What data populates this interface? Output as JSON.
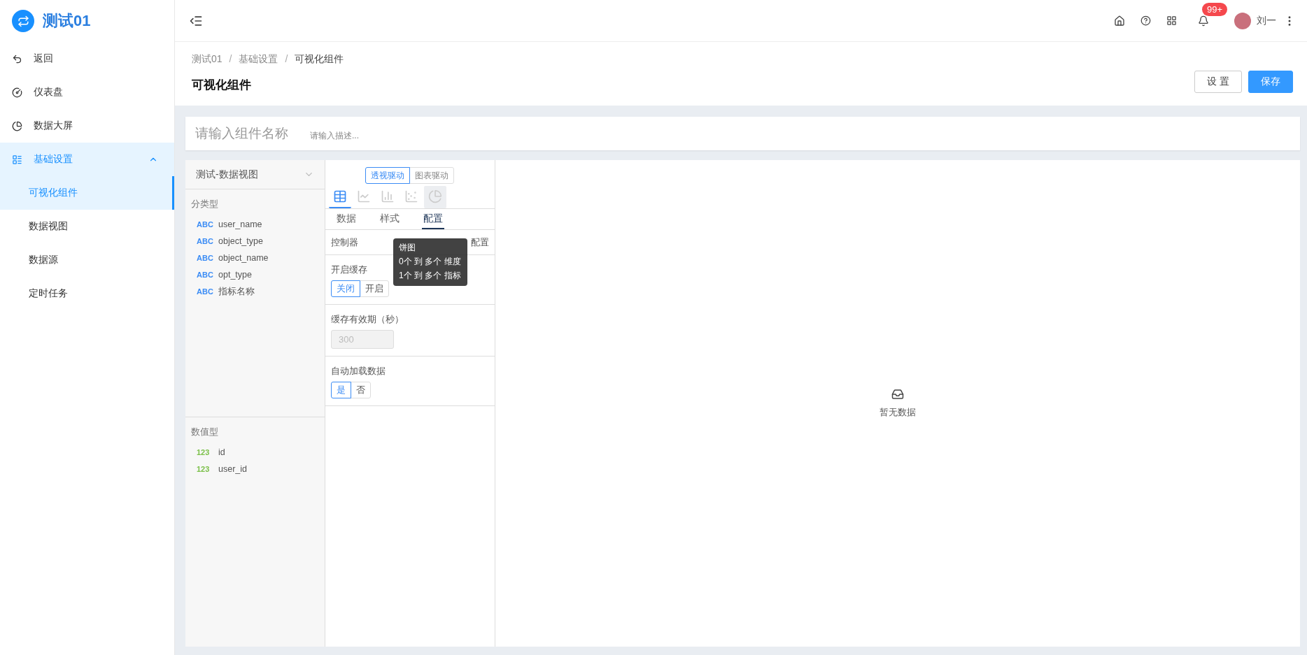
{
  "sidebar": {
    "brand": "测试01",
    "items": [
      {
        "label": "返回",
        "selected": false
      },
      {
        "label": "仪表盘",
        "selected": false
      },
      {
        "label": "数据大屏",
        "selected": false
      },
      {
        "label": "基础设置",
        "selected": false,
        "expanded": true,
        "children": [
          {
            "label": "可视化组件",
            "selected": true
          },
          {
            "label": "数据视图",
            "selected": false
          },
          {
            "label": "数据源",
            "selected": false
          },
          {
            "label": "定时任务",
            "selected": false
          }
        ]
      }
    ]
  },
  "topbar": {
    "badge": "99+",
    "user": "刘一"
  },
  "breadcrumb": {
    "separator": "/",
    "items": [
      "测试01",
      "基础设置",
      "可视化组件"
    ]
  },
  "page_title": "可视化组件",
  "actions": [
    {
      "label": "设 置",
      "kind": "default"
    },
    {
      "label": "保存",
      "kind": "primary"
    }
  ],
  "widget": {
    "name_placeholder": "请输入组件名称",
    "description_placeholder": "请输入描述..."
  },
  "fields": {
    "view": "测试-数据视图",
    "groups": [
      {
        "title": "分类型",
        "kind": "category",
        "items": [
          {
            "type": "ABC",
            "name": "user_name"
          },
          {
            "type": "ABC",
            "name": "object_type"
          },
          {
            "type": "ABC",
            "name": "object_name"
          },
          {
            "type": "ABC",
            "name": "opt_type"
          },
          {
            "type": "ABC",
            "name": "指标名称"
          }
        ]
      },
      {
        "title": "数值型",
        "kind": "value",
        "items": [
          {
            "type": "123",
            "name": "id"
          },
          {
            "type": "123",
            "name": "user_id"
          }
        ]
      }
    ]
  },
  "config": {
    "modes": [
      {
        "label": "透视驱动",
        "selected": true
      },
      {
        "label": "图表驱动",
        "selected": false
      }
    ],
    "chart_types": [
      {
        "selected": true,
        "hovered": false
      },
      {
        "selected": false,
        "hovered": false
      },
      {
        "selected": false,
        "hovered": false
      },
      {
        "selected": false,
        "hovered": false
      },
      {
        "selected": false,
        "hovered": true
      }
    ],
    "tabs": [
      {
        "label": "数据",
        "selected": false
      },
      {
        "label": "样式",
        "selected": false
      },
      {
        "label": "配置",
        "selected": true
      }
    ],
    "controller": {
      "label": "控制器",
      "link": "配置"
    },
    "tooltip": {
      "title": "饼图",
      "lines": [
        "0个 到 多个 维度",
        "1个 到 多个 指标"
      ]
    },
    "sections": [
      {
        "kind": "toggle",
        "label": "开启缓存",
        "options": [
          {
            "label": "关闭",
            "selected": true
          },
          {
            "label": "开启",
            "selected": false
          }
        ]
      },
      {
        "kind": "input",
        "label": "缓存有效期（秒）",
        "value": "300",
        "disabled": true
      },
      {
        "kind": "toggle",
        "label": "自动加载数据",
        "options": [
          {
            "label": "是",
            "selected": true
          },
          {
            "label": "否",
            "selected": false
          }
        ]
      }
    ]
  },
  "preview": {
    "empty_text": "暂无数据"
  }
}
